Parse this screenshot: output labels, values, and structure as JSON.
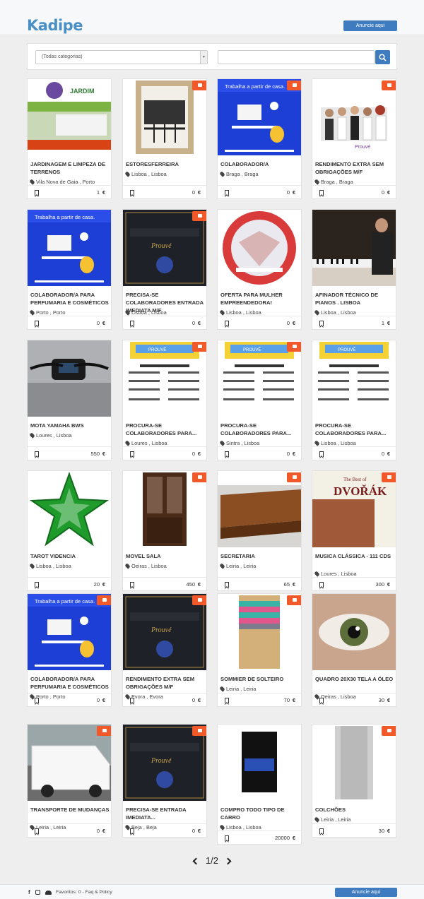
{
  "header": {
    "logo": "Kadipe",
    "cta": "Anuncie aqui"
  },
  "search": {
    "category": "(Todas categorias)",
    "query": ""
  },
  "listings": [
    {
      "title": "JARDINAGEM E LIMPEZA DE TERRENOS",
      "location": "Vila Nova de Gaia , Porto",
      "price": "1",
      "currency": "€",
      "featured": false,
      "thumb": "garden"
    },
    {
      "title": "ESTORESFERREIRA",
      "location": "Lisboa , Lisboa",
      "price": "0",
      "currency": "€",
      "featured": true,
      "thumb": "window"
    },
    {
      "title": "COLABORADOR/A",
      "location": "Braga , Braga",
      "price": "0",
      "currency": "€",
      "featured": true,
      "thumb": "remote"
    },
    {
      "title": "RENDIMENTO EXTRA SEM OBRIGAÇÕES M/F",
      "location": "Braga , Braga",
      "price": "0",
      "currency": "€",
      "featured": true,
      "thumb": "team"
    },
    {
      "title": "COLABORADOR/A PARA PERFUMARIA E COSMÉTICOS",
      "location": "Porto , Porto",
      "price": "0",
      "currency": "€",
      "featured": false,
      "thumb": "remote"
    },
    {
      "title": "PRECISA-SE COLABORADORES ENTRADA IMEDIATA M/F",
      "location": "Lisboa , Lisboa",
      "price": "0",
      "currency": "€",
      "featured": true,
      "thumb": "award"
    },
    {
      "title": "OFERTA PARA MULHER EMPREENDEDORA!",
      "location": "Lisboa , Lisboa",
      "price": "0",
      "currency": "€",
      "featured": false,
      "thumb": "gem"
    },
    {
      "title": "AFINADOR TÉCNICO DE PIANOS . LISBOA",
      "location": "Lisboa , Lisboa",
      "price": "1",
      "currency": "€",
      "featured": false,
      "thumb": "piano"
    },
    {
      "title": "MOTA YAMAHA BWS",
      "location": "Loures , Lisboa",
      "price": "550",
      "currency": "€",
      "featured": false,
      "thumb": "moto"
    },
    {
      "title": "PROCURA-SE COLABORADORES PARA...",
      "location": "Loures , Lisboa",
      "price": "0",
      "currency": "€",
      "featured": true,
      "thumb": "prouve"
    },
    {
      "title": "PROCURA-SE COLABORADORES PARA...",
      "location": "Sintra , Lisboa",
      "price": "0",
      "currency": "€",
      "featured": true,
      "thumb": "prouve"
    },
    {
      "title": "PROCURA-SE COLABORADORES PARA...",
      "location": "Lisboa , Lisboa",
      "price": "0",
      "currency": "€",
      "featured": false,
      "thumb": "prouve"
    },
    {
      "title": "TAROT VIDENCIA",
      "location": "Lisboa , Lisboa",
      "price": "20",
      "currency": "€",
      "featured": false,
      "thumb": "star"
    },
    {
      "title": "MOVEL SALA",
      "location": "Oeiras , Lisboa",
      "price": "450",
      "currency": "€",
      "featured": true,
      "thumb": "cabinet"
    },
    {
      "title": "SECRETARIA",
      "location": "Leiria , Leiria",
      "price": "65",
      "currency": "€",
      "featured": true,
      "thumb": "desk"
    },
    {
      "title": "MUSICA CLÁSSICA - 111 CDS",
      "location": "Loures , Lisboa",
      "price": "300",
      "currency": "€",
      "featured": true,
      "thumb": "dvorak"
    },
    {
      "title": "COLABORADOR/A PARA PERFUMARIA E COSMÉTICOS",
      "location": "Porto , Porto",
      "price": "0",
      "currency": "€",
      "featured": true,
      "thumb": "remote"
    },
    {
      "title": "RENDIMENTO EXTRA SEM OBRIGAÇÕES M/F",
      "location": "Evora , Evora",
      "price": "0",
      "currency": "€",
      "featured": true,
      "thumb": "award"
    },
    {
      "title": "SOMMIER DE SOLTEIRO",
      "location": "Leiria , Leiria",
      "price": "70",
      "currency": "€",
      "featured": true,
      "thumb": "sommier"
    },
    {
      "title": "QUADRO 20X30 TELA A ÓLEO",
      "location": "Oeiras , Lisboa",
      "price": "30",
      "currency": "€",
      "featured": false,
      "thumb": "eye"
    },
    {
      "title": "TRANSPORTE DE MUDANÇAS",
      "location": "Leiria , Leiria",
      "price": "0",
      "currency": "€",
      "featured": true,
      "thumb": "van"
    },
    {
      "title": "PRECISA-SE ENTRADA IMEDIATA...",
      "location": "Beja , Beja",
      "price": "0",
      "currency": "€",
      "featured": true,
      "thumb": "award"
    },
    {
      "title": "COMPRO TODO TIPO DE CARRO",
      "location": "Lisboa , Lisboa",
      "price": "20000",
      "currency": "€",
      "featured": false,
      "thumb": "car"
    },
    {
      "title": "COLCHÕES",
      "location": "Leiria , Leiria",
      "price": "30",
      "currency": "€",
      "featured": true,
      "thumb": "mattress"
    }
  ],
  "pagination": {
    "label": "1/2"
  },
  "footer": {
    "favorites": "Favoritos: 0",
    "separator": "-",
    "faq": "Faq & Policy",
    "cta": "Anuncie aqui"
  },
  "colors": {
    "accent": "#3f7cbf",
    "ribbon": "#f1592a",
    "logo": "#4a90c4"
  }
}
